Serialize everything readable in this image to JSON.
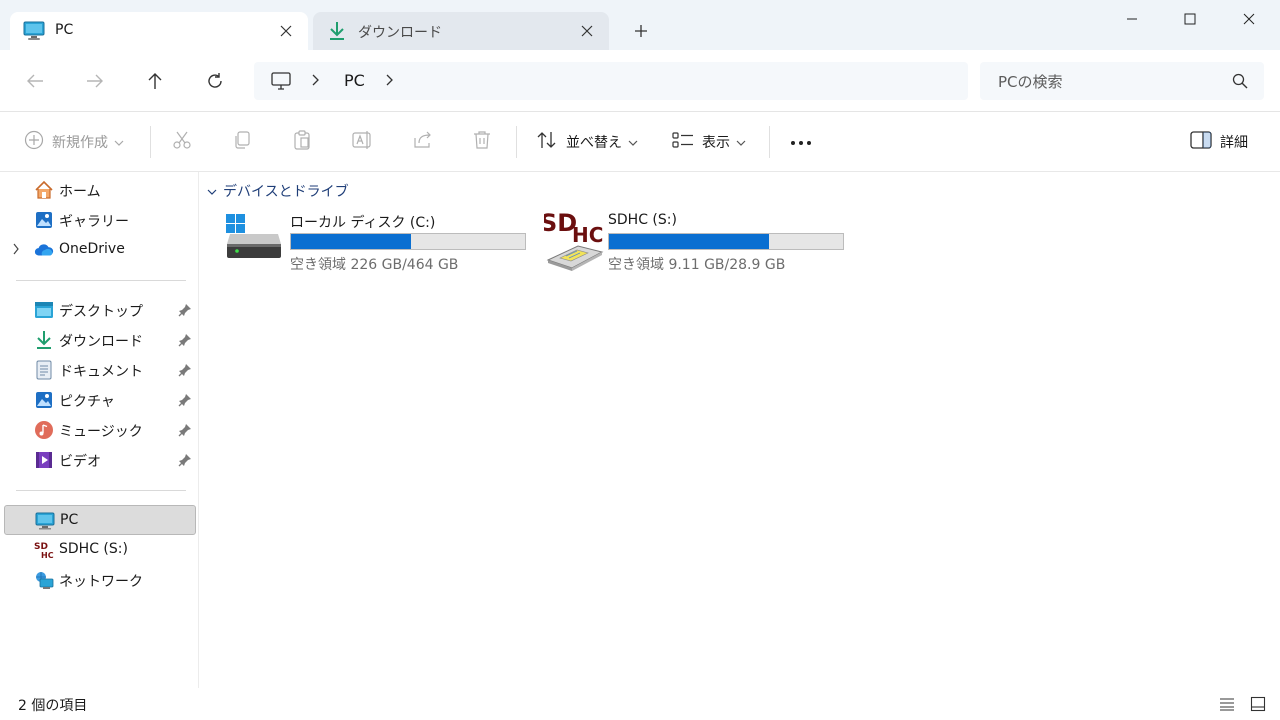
{
  "tabs": [
    {
      "label": "PC",
      "icon": "monitor-icon",
      "active": true
    },
    {
      "label": "ダウンロード",
      "icon": "download-icon",
      "active": false
    }
  ],
  "address": {
    "crumb": "PC",
    "search_placeholder": "PCの検索"
  },
  "commands": {
    "new": "新規作成",
    "sort": "並べ替え",
    "view": "表示",
    "details": "詳細"
  },
  "sidebar": {
    "top": [
      {
        "label": "ホーム",
        "icon": "home-icon"
      },
      {
        "label": "ギャラリー",
        "icon": "gallery-icon"
      },
      {
        "label": "OneDrive",
        "icon": "onedrive-cloud-icon"
      }
    ],
    "pinned": [
      {
        "label": "デスクトップ",
        "icon": "desktop-folder-icon"
      },
      {
        "label": "ダウンロード",
        "icon": "download-icon"
      },
      {
        "label": "ドキュメント",
        "icon": "document-icon"
      },
      {
        "label": "ピクチャ",
        "icon": "pictures-icon"
      },
      {
        "label": "ミュージック",
        "icon": "music-icon"
      },
      {
        "label": "ビデオ",
        "icon": "video-icon"
      }
    ],
    "devices": [
      {
        "label": "PC",
        "icon": "monitor-icon",
        "selected": true
      },
      {
        "label": "SDHC (S:)",
        "icon": "sdhc-icon"
      },
      {
        "label": "ネットワーク",
        "icon": "network-icon"
      }
    ]
  },
  "main": {
    "group_label": "デバイスとドライブ",
    "drives": [
      {
        "name": "ローカル ディスク (C:)",
        "free_text": "空き領域 226 GB/464 GB",
        "used_fraction": 0.513,
        "icon": "windows-drive-icon"
      },
      {
        "name": "SDHC (S:)",
        "free_text": "空き領域 9.11 GB/28.9 GB",
        "used_fraction": 0.685,
        "icon": "sdhc-card-icon"
      }
    ]
  },
  "status": {
    "count": "2 個の項目"
  },
  "colors": {
    "accent": "#0a6fd1",
    "tabbar": "#eff4f9",
    "group_header": "#1f3e78"
  }
}
